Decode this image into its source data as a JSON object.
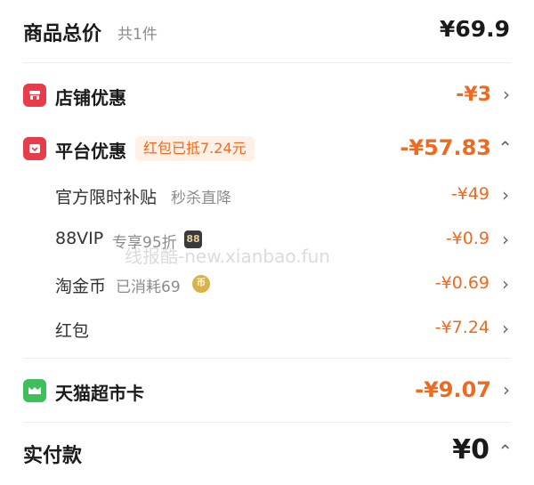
{
  "total": {
    "label": "商品总价",
    "count": "共1件",
    "amount": "¥69.9"
  },
  "store": {
    "label": "店铺优惠",
    "amount": "-¥3"
  },
  "platform": {
    "label": "平台优惠",
    "pill": "红包已抵7.24元",
    "amount": "-¥57.83"
  },
  "subs": [
    {
      "label": "官方限时补贴",
      "note": "秒杀直降",
      "amount": "-¥49"
    },
    {
      "label": "88VIP",
      "note": "专享95折",
      "badge": "88",
      "amount": "-¥0.9"
    },
    {
      "label": "淘金币",
      "note": "已消耗69",
      "coin": "币",
      "amount": "-¥0.69"
    },
    {
      "label": "红包",
      "amount": "-¥7.24"
    }
  ],
  "card": {
    "label": "天猫超市卡",
    "amount": "-¥9.07"
  },
  "pay": {
    "label": "实付款",
    "amount": "¥0"
  },
  "watermark": "线报酷-new.xianbao.fun",
  "colors": {
    "accent": "#ee6a1e",
    "store_icon": "#e73d4a",
    "platform_icon": "#e73d4a",
    "card_icon": "#3fbf5c"
  }
}
